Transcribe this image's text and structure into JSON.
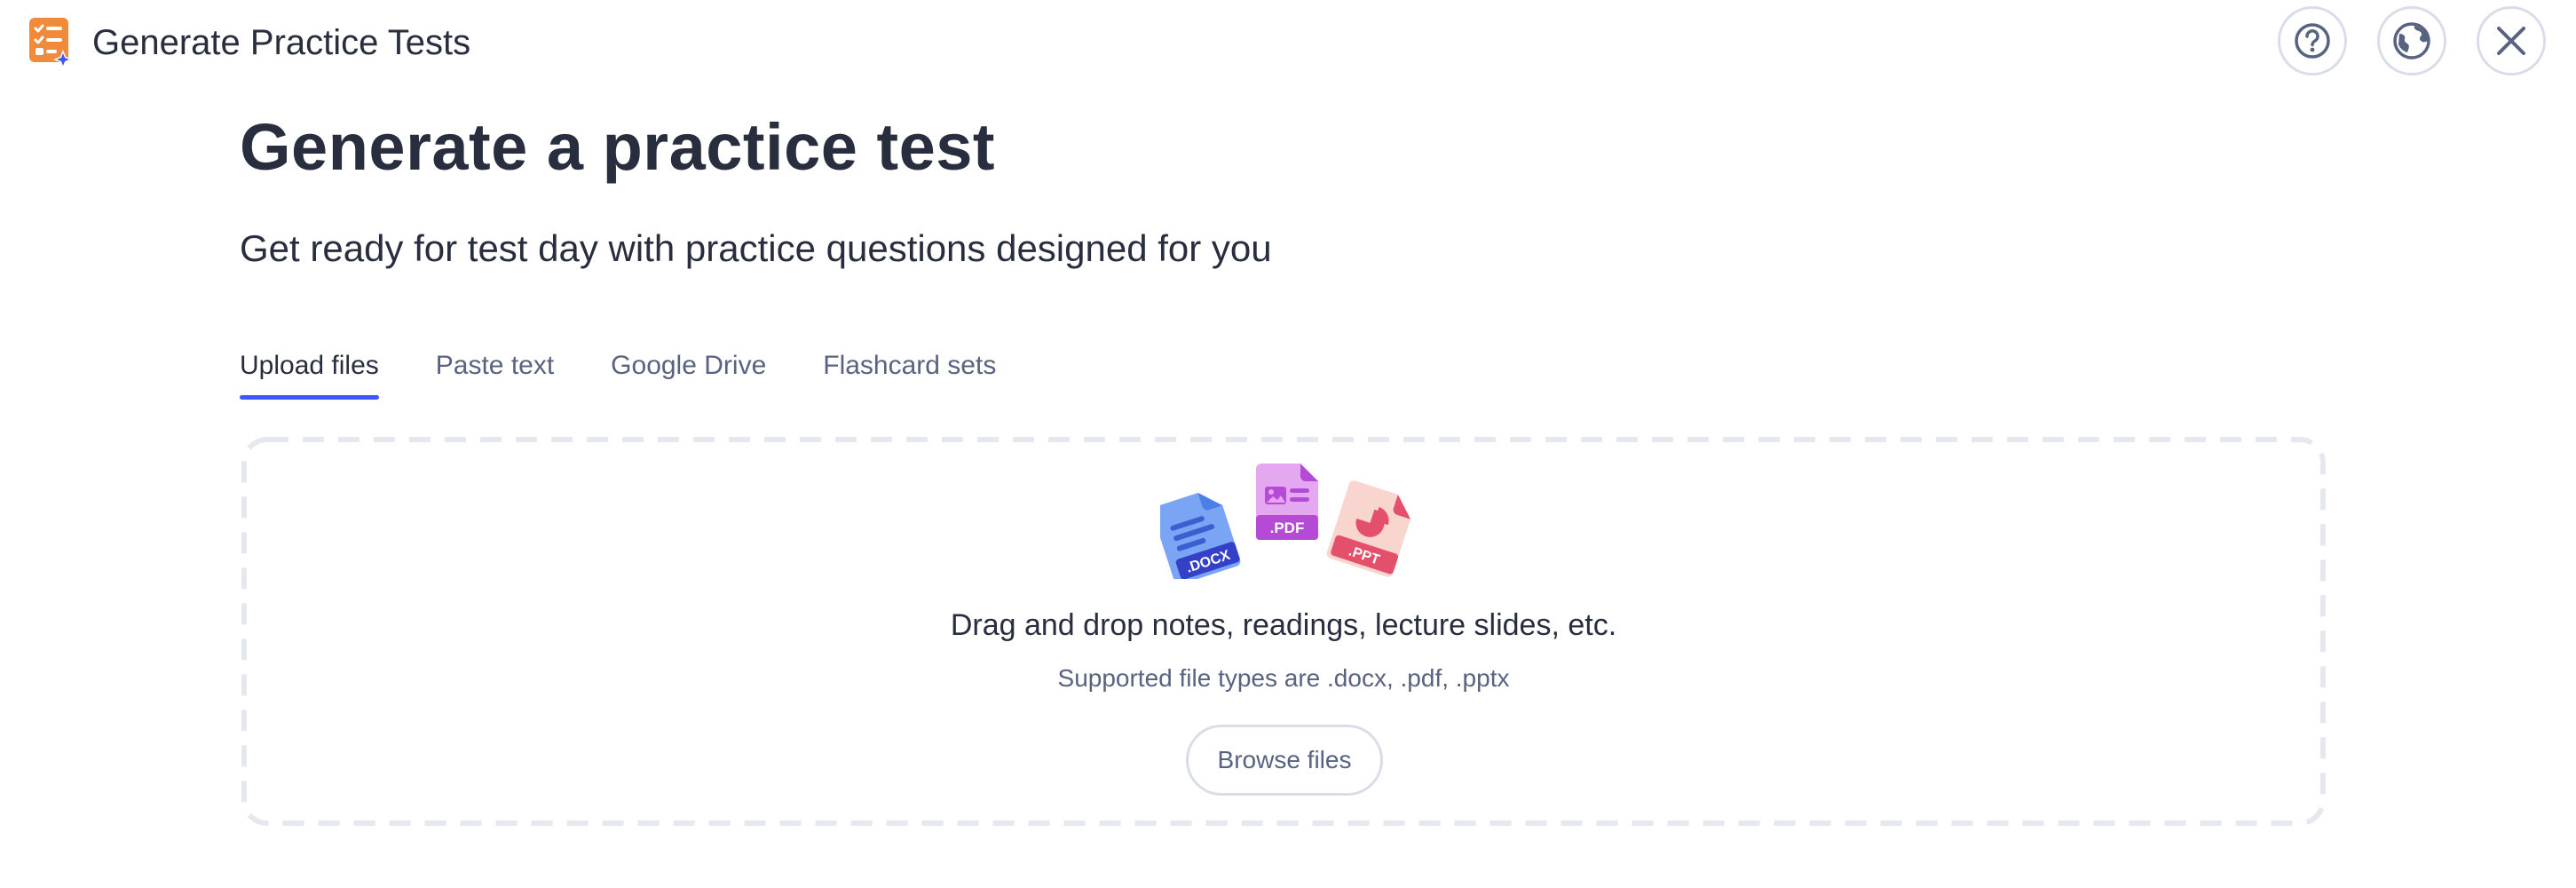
{
  "header": {
    "app_title": "Generate Practice Tests",
    "app_icon": "checklist-sparkle-icon",
    "buttons": {
      "help_icon": "question-circle-icon",
      "language_icon": "globe-icon",
      "close_icon": "close-icon"
    }
  },
  "main": {
    "heading": "Generate a practice test",
    "subheading": "Get ready for test day with practice questions designed for you"
  },
  "tabs": [
    {
      "label": "Upload files",
      "active": true
    },
    {
      "label": "Paste text",
      "active": false
    },
    {
      "label": "Google Drive",
      "active": false
    },
    {
      "label": "Flashcard sets",
      "active": false
    }
  ],
  "upload": {
    "file_badges": {
      "docx": ".DOCX",
      "pdf": ".PDF",
      "ppt": ".PPT"
    },
    "drop_title": "Drag and drop notes, readings, lecture slides, etc.",
    "supported_types": "Supported file types are .docx, .pdf, .pptx",
    "browse_label": "Browse files"
  },
  "colors": {
    "text_primary": "#282e3e",
    "text_secondary": "#586380",
    "accent": "#4255ff",
    "border": "#d9dde8",
    "app_icon_orange": "#f08b3c",
    "docx_blue": "#4d7fe8",
    "pdf_purple": "#b54ad6",
    "ppt_red": "#e4506b"
  }
}
